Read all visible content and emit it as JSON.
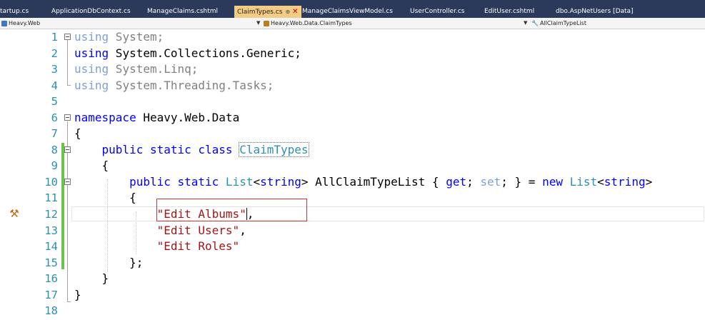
{
  "tabs": [
    {
      "label": "tartup.cs"
    },
    {
      "label": "ApplicationDbContext.cs"
    },
    {
      "label": "ManageClaims.cshtml"
    },
    {
      "label": "ClaimTypes.cs",
      "pin": "⊕",
      "close": "✕"
    },
    {
      "label": "ManageClaimsViewModel.cs"
    },
    {
      "label": "UserController.cs"
    },
    {
      "label": "EditUser.cshtml"
    },
    {
      "label": "dbo.AspNetUsers [Data]"
    }
  ],
  "navbar": {
    "project": "Heavy.Web",
    "type": "Heavy.Web.Data.ClaimTypes",
    "member": "AllClaimTypeList"
  },
  "line_numbers": [
    "1",
    "2",
    "3",
    "4",
    "5",
    "6",
    "7",
    "8",
    "9",
    "10",
    "11",
    "12",
    "13",
    "14",
    "15",
    "16",
    "17",
    "18"
  ],
  "code": {
    "l1": {
      "kw": "using",
      "rest": " System;"
    },
    "l2": {
      "kw": "using",
      "rest": " System.Collections.Generic;"
    },
    "l3": {
      "kw": "using",
      "rest": " System.Linq;"
    },
    "l4": {
      "kw": "using",
      "rest": " System.Threading.Tasks;"
    },
    "l6": {
      "kw": "namespace",
      "rest": " Heavy.Web.Data"
    },
    "l7": "{",
    "l8": {
      "kw": "    public static class ",
      "type": "ClaimTypes"
    },
    "l9": "    {",
    "l10": {
      "kw1": "        public static ",
      "type1": "List",
      "t1": "<",
      "kw2": "string",
      "t2": "> AllClaimTypeList { ",
      "get": "get",
      "semi1": "; ",
      "set": "set",
      "semi2": "; } = ",
      "new": "new",
      "sp": " ",
      "type2": "List",
      "t3": "<",
      "kw3": "string",
      "t4": ">"
    },
    "l11": "        {",
    "l12": {
      "indent": "            ",
      "str": "\"Edit Albums\"",
      "after": ","
    },
    "l13": {
      "indent": "            ",
      "str": "\"Edit Users\"",
      "after": ","
    },
    "l14": {
      "indent": "            ",
      "str": "\"Edit Roles\""
    },
    "l15": "        };",
    "l16": "    }",
    "l17": "}"
  },
  "margin_icons": {
    "line12": "hammer-screwdriver"
  },
  "colors": {
    "tab_strip_bg": "#2b3a5a",
    "active_tab_bg": "#f5cc84",
    "keyword": "#0000ff",
    "type": "#2b91af",
    "string": "#a31515",
    "line_number": "#2b91af",
    "change_bar": "#6cc24a",
    "annotation_box": "#d9322b"
  }
}
